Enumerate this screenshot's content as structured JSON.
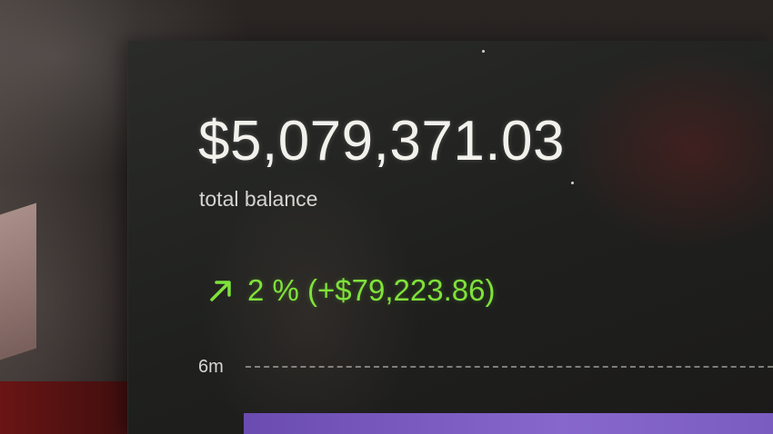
{
  "balance": {
    "amount": "$5,079,371.03",
    "label": "total balance"
  },
  "change": {
    "icon": "arrow-up-right-icon",
    "text": "2 % (+$79,223.86)",
    "color": "#7fe23a"
  },
  "chart": {
    "range_label": "6m",
    "bar_color": "#8767cc"
  }
}
